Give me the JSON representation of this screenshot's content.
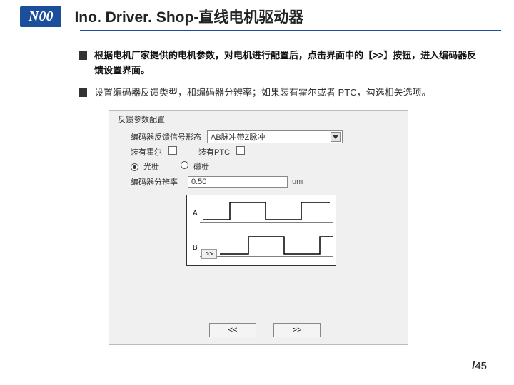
{
  "header": {
    "badge": "N00",
    "title": "Ino. Driver. Shop-直线电机驱动器"
  },
  "bullets": [
    "根据电机厂家提供的电机参数，对电机进行配置后，点击界面中的【>>】按钮，进入编码器反馈设置界面。",
    "设置编码器反馈类型，和编码器分辨率；如果装有霍尔或者 PTC，勾选相关选项。"
  ],
  "dialog": {
    "group_label": "反馈参数配置",
    "feedback_type_label": "编码器反馈信号形态",
    "feedback_type_value": "AB脉冲带Z脉冲",
    "hall_label": "装有霍尔",
    "ptc_label": "装有PTC",
    "radio_optical": "光栅",
    "radio_magnetic": "磁栅",
    "resolution_label": "编码器分辨率",
    "resolution_value": "0.50",
    "resolution_unit": "um",
    "diagram": {
      "a_label": "A",
      "b_label": "B",
      "prev_btn": ">>"
    },
    "btn_prev": "<<",
    "btn_next": ">>"
  },
  "footer": {
    "slash": "/",
    "page": "45"
  }
}
